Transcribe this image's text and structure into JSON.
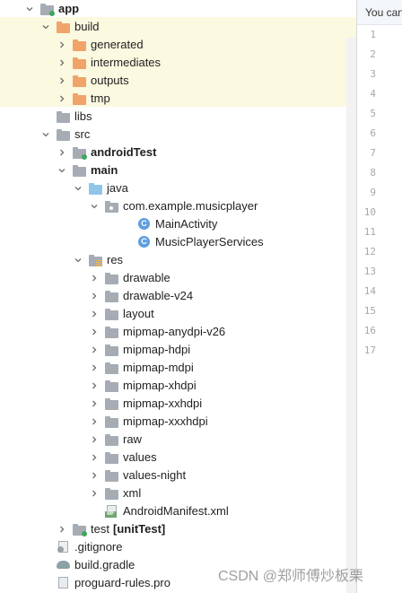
{
  "project_tree": {
    "items": [
      {
        "label": "app",
        "bold": true,
        "depth": 0,
        "arrow": "expanded",
        "icon": "module-folder-icon",
        "badge": "green"
      },
      {
        "label": "build",
        "bold": false,
        "depth": 1,
        "arrow": "expanded",
        "icon": "folder-orange-icon"
      },
      {
        "label": "generated",
        "bold": false,
        "depth": 2,
        "arrow": "collapsed",
        "icon": "folder-orange-icon"
      },
      {
        "label": "intermediates",
        "bold": false,
        "depth": 2,
        "arrow": "collapsed",
        "icon": "folder-orange-icon"
      },
      {
        "label": "outputs",
        "bold": false,
        "depth": 2,
        "arrow": "collapsed",
        "icon": "folder-orange-icon"
      },
      {
        "label": "tmp",
        "bold": false,
        "depth": 2,
        "arrow": "collapsed",
        "icon": "folder-orange-icon"
      },
      {
        "label": "libs",
        "bold": false,
        "depth": 1,
        "arrow": "none",
        "icon": "folder-grey-icon"
      },
      {
        "label": "src",
        "bold": false,
        "depth": 1,
        "arrow": "expanded",
        "icon": "folder-grey-icon"
      },
      {
        "label": "androidTest",
        "bold": true,
        "depth": 2,
        "arrow": "collapsed",
        "icon": "folder-grey-icon",
        "badge": "green"
      },
      {
        "label": "main",
        "bold": true,
        "depth": 2,
        "arrow": "expanded",
        "icon": "folder-grey-icon"
      },
      {
        "label": "java",
        "bold": false,
        "depth": 3,
        "arrow": "expanded",
        "icon": "folder-blue-icon"
      },
      {
        "label": "com.example.musicplayer",
        "bold": false,
        "depth": 4,
        "arrow": "expanded",
        "icon": "package-icon"
      },
      {
        "label": "MainActivity",
        "bold": false,
        "depth": 6,
        "arrow": "none",
        "icon": "class-icon"
      },
      {
        "label": "MusicPlayerServices",
        "bold": false,
        "depth": 6,
        "arrow": "none",
        "icon": "class-icon"
      },
      {
        "label": "res",
        "bold": false,
        "depth": 3,
        "arrow": "expanded",
        "icon": "res-folder-icon"
      },
      {
        "label": "drawable",
        "bold": false,
        "depth": 4,
        "arrow": "collapsed",
        "icon": "folder-grey-icon"
      },
      {
        "label": "drawable-v24",
        "bold": false,
        "depth": 4,
        "arrow": "collapsed",
        "icon": "folder-grey-icon"
      },
      {
        "label": "layout",
        "bold": false,
        "depth": 4,
        "arrow": "collapsed",
        "icon": "folder-grey-icon"
      },
      {
        "label": "mipmap-anydpi-v26",
        "bold": false,
        "depth": 4,
        "arrow": "collapsed",
        "icon": "folder-grey-icon"
      },
      {
        "label": "mipmap-hdpi",
        "bold": false,
        "depth": 4,
        "arrow": "collapsed",
        "icon": "folder-grey-icon"
      },
      {
        "label": "mipmap-mdpi",
        "bold": false,
        "depth": 4,
        "arrow": "collapsed",
        "icon": "folder-grey-icon"
      },
      {
        "label": "mipmap-xhdpi",
        "bold": false,
        "depth": 4,
        "arrow": "collapsed",
        "icon": "folder-grey-icon"
      },
      {
        "label": "mipmap-xxhdpi",
        "bold": false,
        "depth": 4,
        "arrow": "collapsed",
        "icon": "folder-grey-icon"
      },
      {
        "label": "mipmap-xxxhdpi",
        "bold": false,
        "depth": 4,
        "arrow": "collapsed",
        "icon": "folder-grey-icon"
      },
      {
        "label": "raw",
        "bold": false,
        "depth": 4,
        "arrow": "collapsed",
        "icon": "folder-grey-icon"
      },
      {
        "label": "values",
        "bold": false,
        "depth": 4,
        "arrow": "collapsed",
        "icon": "folder-grey-icon"
      },
      {
        "label": "values-night",
        "bold": false,
        "depth": 4,
        "arrow": "collapsed",
        "icon": "folder-grey-icon"
      },
      {
        "label": "xml",
        "bold": false,
        "depth": 4,
        "arrow": "collapsed",
        "icon": "folder-grey-icon"
      },
      {
        "label": "AndroidManifest.xml",
        "bold": false,
        "depth": 4,
        "arrow": "none",
        "icon": "manifest-icon"
      },
      {
        "label": "test",
        "bold": false,
        "depth": 2,
        "arrow": "collapsed",
        "icon": "folder-grey-icon",
        "badge": "green",
        "suffix": "[unitTest]"
      },
      {
        "label": ".gitignore",
        "bold": false,
        "depth": 1,
        "arrow": "none",
        "icon": "gitignore-icon"
      },
      {
        "label": "build.gradle",
        "bold": false,
        "depth": 1,
        "arrow": "none",
        "icon": "gradle-icon"
      },
      {
        "label": "proguard-rules.pro",
        "bold": false,
        "depth": 1,
        "arrow": "none",
        "icon": "text-file-icon"
      }
    ]
  },
  "editor": {
    "banner_text": "You can",
    "line_numbers": [
      "1",
      "2",
      "3",
      "4",
      "5",
      "6",
      "7",
      "8",
      "9",
      "10",
      "11",
      "12",
      "13",
      "14",
      "15",
      "16",
      "17"
    ]
  },
  "watermark": {
    "text": "CSDN @郑师傅炒板栗"
  },
  "colors": {
    "build_highlight": "#fbf9e0",
    "folder_orange": "#f0a469",
    "folder_grey": "#a6acb4",
    "folder_blue": "#90c5e8",
    "class_blue": "#5f9ee0",
    "test_badge_green": "#3fa75a"
  }
}
